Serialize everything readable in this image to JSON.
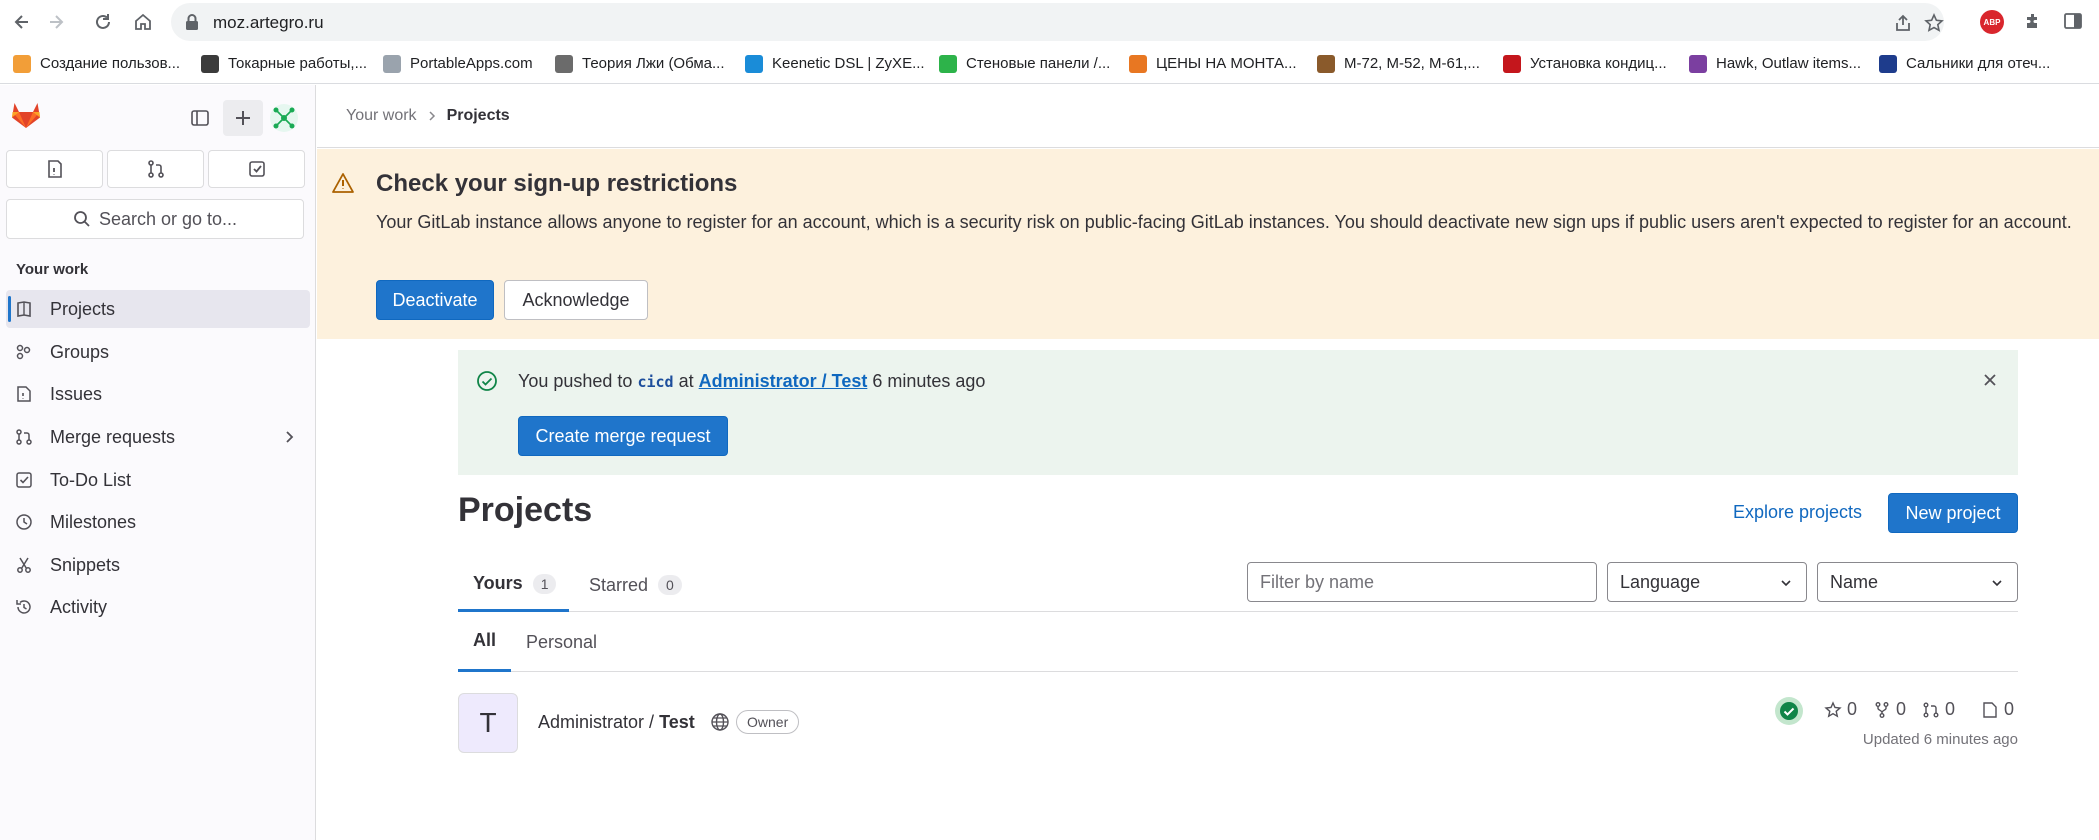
{
  "browser": {
    "url": "moz.artegro.ru",
    "bookmarks": [
      {
        "label": "Создание пользов...",
        "color": "#f29e38"
      },
      {
        "label": "Токарные работы,...",
        "color": "#3b3b3b"
      },
      {
        "label": "PortableApps.com",
        "color": "#9aa3ad"
      },
      {
        "label": "Теория Лжи (Обма...",
        "color": "#6b6b6b"
      },
      {
        "label": "Keenetic DSL | ZyXE...",
        "color": "#1a8cd8"
      },
      {
        "label": "Стеновые панели /...",
        "color": "#2db34a"
      },
      {
        "label": "ЦЕНЫ НА МОНТА...",
        "color": "#e87722"
      },
      {
        "label": "M-72, M-52, M-61,...",
        "color": "#8a5a2b"
      },
      {
        "label": "Установка кондиц...",
        "color": "#c4161c"
      },
      {
        "label": "Hawk, Outlaw items...",
        "color": "#7b3fa0"
      },
      {
        "label": "Сальники для отеч...",
        "color": "#1e3c8c"
      }
    ],
    "abp_label": "ABP"
  },
  "sidebar": {
    "search_placeholder": "Search or go to...",
    "section_title": "Your work",
    "items": [
      {
        "label": "Projects",
        "icon": "project-icon",
        "active": true
      },
      {
        "label": "Groups",
        "icon": "group-icon"
      },
      {
        "label": "Issues",
        "icon": "issues-icon"
      },
      {
        "label": "Merge requests",
        "icon": "merge-request-icon"
      },
      {
        "label": "To-Do List",
        "icon": "todo-icon"
      },
      {
        "label": "Milestones",
        "icon": "milestone-icon"
      },
      {
        "label": "Snippets",
        "icon": "snippet-icon"
      },
      {
        "label": "Activity",
        "icon": "history-icon"
      }
    ]
  },
  "breadcrumb": {
    "home": "Your work",
    "current": "Projects"
  },
  "banner": {
    "title": "Check your sign-up restrictions",
    "body": "Your GitLab instance allows anyone to register for an account, which is a security risk on public-facing GitLab instances. You should deactivate new sign ups if public users aren't expected to register for an account.",
    "deactivate_label": "Deactivate",
    "acknowledge_label": "Acknowledge"
  },
  "push_alert": {
    "prefix": "You pushed to",
    "branch": "cicd",
    "at": "at",
    "project": "Administrator / Test",
    "time": "6 minutes ago",
    "button_label": "Create merge request"
  },
  "page": {
    "title": "Projects",
    "explore_label": "Explore projects",
    "new_project_label": "New project"
  },
  "tabs": [
    {
      "label": "Yours",
      "count": "1",
      "active": true
    },
    {
      "label": "Starred",
      "count": "0"
    }
  ],
  "filters": {
    "name_placeholder": "Filter by name",
    "language_label": "Language",
    "sort_label": "Name"
  },
  "subtabs": [
    {
      "label": "All",
      "active": true
    },
    {
      "label": "Personal"
    }
  ],
  "project": {
    "avatar_letter": "T",
    "namespace": "Administrator /",
    "name": "Test",
    "role": "Owner",
    "stars": "0",
    "forks": "0",
    "merge_requests": "0",
    "issues": "0",
    "updated": "Updated 6 minutes ago"
  }
}
